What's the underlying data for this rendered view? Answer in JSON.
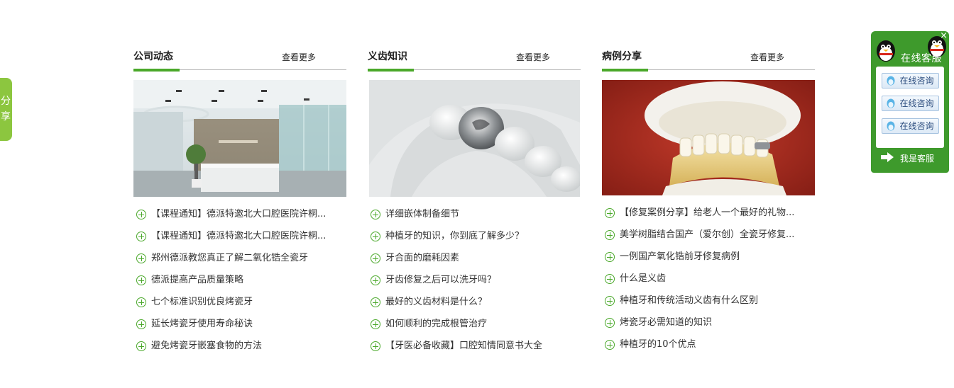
{
  "share_tab": {
    "label_1": "分",
    "label_2": "享"
  },
  "columns": [
    {
      "title": "公司动态",
      "more": "查看更多",
      "image": "reception-lobby-photo",
      "items": [
        "【课程通知】德派特邀北大口腔医院许桐...",
        "【课程通知】德派特邀北大口腔医院许桐...",
        "郑州德派教您真正了解二氧化锆全瓷牙",
        "德派提高产品质量策略",
        "七个标准识别优良烤瓷牙",
        "延长烤瓷牙使用寿命秘诀",
        "避免烤瓷牙嵌塞食物的方法"
      ]
    },
    {
      "title": "义齿知识",
      "more": "查看更多",
      "image": "metal-inlay-tooth-model-photo",
      "items": [
        "详细嵌体制备细节",
        "种植牙的知识，你到底了解多少？",
        "牙合面的磨耗因素",
        "牙齿修复之后可以洗牙吗？",
        "最好的义齿材料是什么？",
        "如何顺利的完成根管治疗",
        "【牙医必备收藏】口腔知情同意书大全"
      ]
    },
    {
      "title": "病例分享",
      "more": "查看更多",
      "image": "dental-bridge-model-photo",
      "items": [
        "【修复案例分享】给老人一个最好的礼物...",
        "美学树脂结合国产（爱尔创）全瓷牙修复...",
        "一例国产氧化锆前牙修复病例",
        "什么是义齿",
        "种植牙和传统活动义齿有什么区别",
        "烤瓷牙必需知道的知识",
        "种植牙的10个优点"
      ]
    }
  ],
  "customer_service": {
    "title": "在线客服",
    "close": "×",
    "buttons": [
      "在线咨询",
      "在线咨询",
      "在线咨询"
    ],
    "footer": "我是客服"
  },
  "colors": {
    "accent_green": "#4aa82a",
    "panel_green": "#3e9a2c",
    "share_green": "#8cc63f"
  }
}
